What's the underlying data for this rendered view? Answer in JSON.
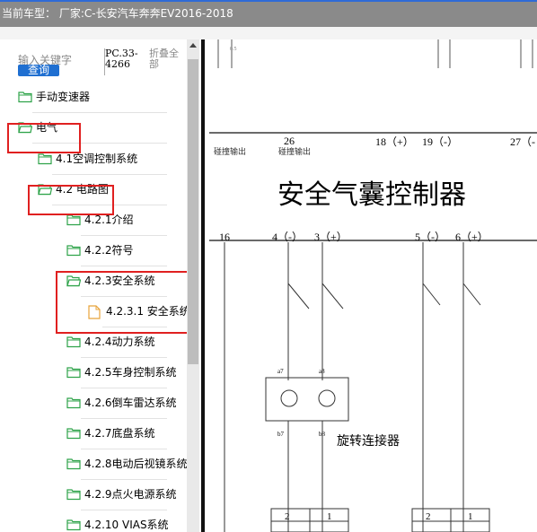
{
  "header": {
    "title": "当前车型：  厂家:C-长安汽车奔奔EV2016-2018"
  },
  "search": {
    "placeholder": "输入关键字",
    "button": "查询",
    "code": "PC.33-4266",
    "collapse": "折叠全部"
  },
  "tree": [
    {
      "label": "手动变速器",
      "icon": "folder-icon"
    },
    {
      "label": "电气",
      "icon": "folder-open-icon"
    },
    {
      "label": "4.1空调控制系统",
      "icon": "folder-icon"
    },
    {
      "label": "4.2 电路图",
      "icon": "folder-open-icon"
    },
    {
      "label": "4.2.1介绍",
      "icon": "folder-icon"
    },
    {
      "label": "4.2.2符号",
      "icon": "folder-icon"
    },
    {
      "label": "4.2.3安全系统",
      "icon": "folder-open-icon"
    },
    {
      "label": "4.2.3.1 安全系统",
      "icon": "document-icon"
    },
    {
      "label": "4.2.4动力系统",
      "icon": "folder-icon"
    },
    {
      "label": "4.2.5车身控制系统",
      "icon": "folder-icon"
    },
    {
      "label": "4.2.6倒车雷达系统",
      "icon": "folder-icon"
    },
    {
      "label": "4.2.7底盘系统",
      "icon": "folder-icon"
    },
    {
      "label": "4.2.8电动后视镜系统",
      "icon": "folder-icon"
    },
    {
      "label": "4.2.9点火电源系统",
      "icon": "folder-icon"
    },
    {
      "label": "4.2.10 VIAS系统",
      "icon": "folder-icon"
    }
  ],
  "diagram": {
    "title": "安全气囊控制器",
    "top_pins": [
      "26",
      "18（+）",
      "19（-）",
      "27（-"
    ],
    "top_pin_label": "碰撞输出",
    "top_pin_label2": "碰撞输出",
    "bottom_pins": [
      "16",
      "4（-）",
      "3（+）",
      "5（-）",
      "6（+）"
    ],
    "connector_label": "旋转连接器",
    "wire_labels": [
      "a7",
      "a8",
      "b7",
      "b8"
    ],
    "wire_gauge": "0.5",
    "box_numbers": [
      "2",
      "1",
      "2",
      "1"
    ]
  }
}
